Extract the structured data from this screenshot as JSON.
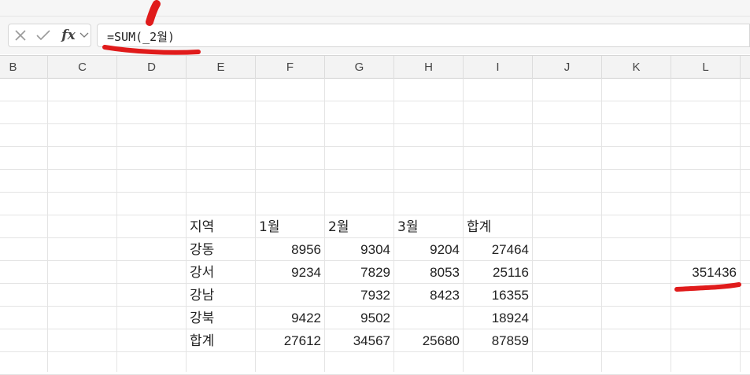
{
  "formula_bar": {
    "cancel_icon": "close-icon",
    "enter_icon": "checkmark-icon",
    "function_label": "fx",
    "formula": "=SUM(_2월)"
  },
  "columns": [
    "B",
    "C",
    "D",
    "E",
    "F",
    "G",
    "H",
    "I",
    "J",
    "K",
    "L"
  ],
  "table": {
    "header": [
      "지역",
      "1월",
      "2월",
      "3월",
      "합계"
    ],
    "rows": [
      {
        "region": "강동",
        "m1": "8956",
        "m2": "9304",
        "m3": "9204",
        "total": "27464"
      },
      {
        "region": "강서",
        "m1": "9234",
        "m2": "7829",
        "m3": "8053",
        "total": "25116"
      },
      {
        "region": "강남",
        "m1": "",
        "m2": "7932",
        "m3": "8423",
        "total": "16355"
      },
      {
        "region": "강북",
        "m1": "9422",
        "m2": "9502",
        "m3": "",
        "total": "18924"
      },
      {
        "region": "합계",
        "m1": "27612",
        "m2": "34567",
        "m3": "25680",
        "total": "87859"
      }
    ]
  },
  "result_cell": {
    "column": "L",
    "value": "351436"
  },
  "annotation_color": "#e01b1b"
}
